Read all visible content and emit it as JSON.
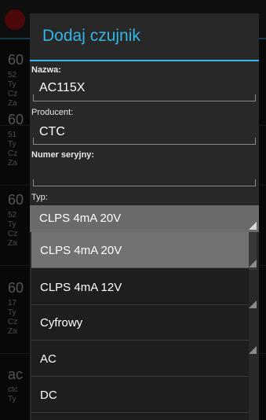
{
  "background": {
    "items": [
      {
        "big": "60",
        "lines": [
          "52",
          "Ty",
          "Cz",
          "Za"
        ]
      },
      {
        "big": "60",
        "lines": [
          "51",
          "Ty",
          "Cz",
          "Za"
        ]
      },
      {
        "big": "60",
        "lines": [
          "52",
          "Ty",
          "Cz",
          "Za"
        ]
      },
      {
        "big": "60",
        "lines": [
          "17",
          "Ty",
          "Cz",
          "Za"
        ]
      },
      {
        "big": "ac",
        "lines": [
          "ctc",
          "Ty"
        ]
      }
    ]
  },
  "dialog": {
    "title": "Dodaj czujnik",
    "fields": {
      "nazwa_label": "Nazwa:",
      "nazwa_value": "AC115X",
      "producent_label": "Producent:",
      "producent_value": "CTC",
      "numer_label": "Numer seryjny:",
      "numer_value": "",
      "typ_label": "Typ:"
    },
    "spinner_value": "CLPS 4mA 20V"
  },
  "dropdown": {
    "options": [
      "CLPS 4mA 20V",
      "CLPS 4mA 12V",
      "Cyfrowy",
      "AC",
      "DC"
    ],
    "selected_index": 0
  },
  "colors": {
    "accent": "#33b5e5",
    "dialog_bg": "#282828",
    "selected_bg": "#727272"
  }
}
